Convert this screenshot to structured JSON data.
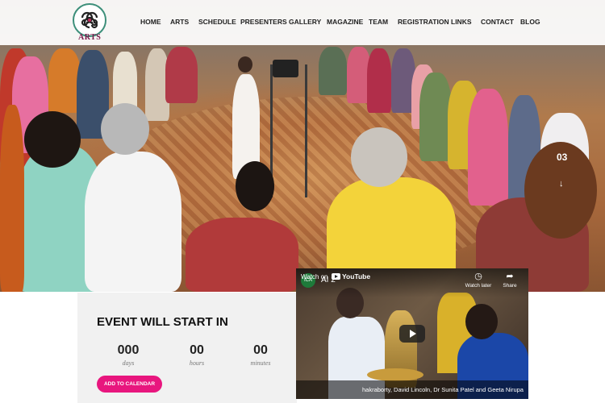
{
  "header": {
    "logo_text": "ARTS",
    "nav": [
      "HOME",
      "ARTS",
      "SCHEDULE",
      "PRESENTERS",
      "GALLERY",
      "MAGAZINE",
      "TEAM",
      "REGISTRATION",
      "LINKS",
      "CONTACT",
      "BLOG"
    ]
  },
  "slider": {
    "current": "03",
    "arrow": "↓"
  },
  "countdown": {
    "title": "EVENT WILL START IN",
    "units": [
      {
        "value": "000",
        "label": "days"
      },
      {
        "value": "00",
        "label": "hours"
      },
      {
        "value": "00",
        "label": "minutes"
      }
    ],
    "button": "ADD TO CALENDAR"
  },
  "video": {
    "title": "AI 2",
    "channel_icon": "ICA",
    "watch_later": "Watch later",
    "share": "Share",
    "watch_on": "Watch on",
    "youtube": "YouTube",
    "caption": "hakraborty, David Lincoln, Dr Sunita Patel and Geeta Nirupa"
  },
  "colors": {
    "accent": "#e8167e",
    "countdown_bg": "#f1f1f1"
  }
}
